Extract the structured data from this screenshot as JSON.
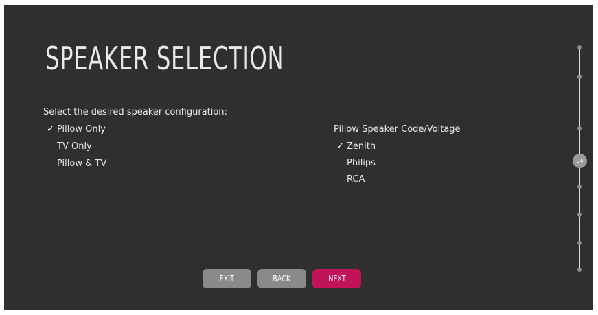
{
  "title": "SPEAKER SELECTION",
  "speaker_config": {
    "prompt": "Select the desired speaker configuration:",
    "check_glyph": "✓",
    "options": [
      {
        "label": "Pillow Only",
        "selected": true
      },
      {
        "label": "TV Only",
        "selected": false
      },
      {
        "label": "Pillow & TV",
        "selected": false
      }
    ]
  },
  "pillow_code": {
    "heading": "Pillow Speaker Code/Voltage",
    "options": [
      {
        "label": "Zenith",
        "selected": true
      },
      {
        "label": "Philips",
        "selected": false
      },
      {
        "label": "RCA",
        "selected": false
      }
    ]
  },
  "buttons": {
    "exit": "EXIT",
    "back": "BACK",
    "next": "NEXT"
  },
  "progress": {
    "current_step": "04"
  },
  "colors": {
    "background": "#2f2f2f",
    "accent": "#c2125a",
    "button_neutral": "#8a8a8a"
  }
}
